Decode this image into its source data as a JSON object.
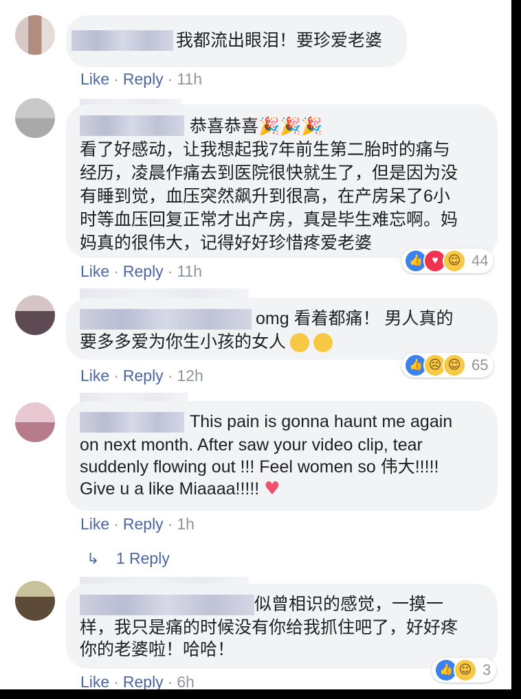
{
  "comments": [
    {
      "lines": [
        "我都流出眼泪！要珍爱老婆"
      ],
      "actions": {
        "like": "Like",
        "reply": "Reply",
        "time": "11h"
      }
    },
    {
      "lines": [
        "恭喜恭喜🎉🎉🎉",
        "看了好感动，让我想起我7年前生第二胎时的痛与",
        "经历，凌晨作痛去到医院很快就生了，但是因为没",
        "有睡到觉，血压突然飙升到很高，在产房呆了6小",
        "时等血压回复正常才出产房，真是毕生难忘啊。妈",
        "妈真的很伟大，记得好好珍惜疼爱老婆"
      ],
      "actions": {
        "like": "Like",
        "reply": "Reply",
        "time": "11h"
      },
      "reactions": {
        "icons": [
          "like-icon",
          "love-icon",
          "haha-icon"
        ],
        "count": "44"
      }
    },
    {
      "lines": [
        "omg 看着都痛！ 男人真的",
        "要多多爱为你生小孩的女人"
      ],
      "actions": {
        "like": "Like",
        "reply": "Reply",
        "time": "12h"
      },
      "reactions": {
        "icons": [
          "like-icon",
          "sad-icon",
          "haha-icon"
        ],
        "count": "65"
      }
    },
    {
      "lines": [
        "This pain is gonna haunt me again",
        "on next month. After saw your video clip, tear",
        "suddenly flowing out !!! Feel women so 伟大!!!!!",
        "Give u a like Miaaaa!!!!!"
      ],
      "actions": {
        "like": "Like",
        "reply": "Reply",
        "time": "1h"
      },
      "replies_link": "1 Reply"
    },
    {
      "lines": [
        "似曾相识的感觉，一摸一",
        "样，我只是痛的时候没有你给我抓住吧了，好好疼",
        "你的老婆啦！哈哈！"
      ],
      "actions": {
        "like": "Like",
        "reply": "Reply",
        "time": "6h"
      },
      "reactions": {
        "icons": [
          "like-icon",
          "haha-icon"
        ],
        "count": "3"
      }
    }
  ],
  "colors": {
    "link": "#4b67a1",
    "meta": "#90949c",
    "bubble": "#f2f3f5",
    "text": "#1c1e21"
  }
}
